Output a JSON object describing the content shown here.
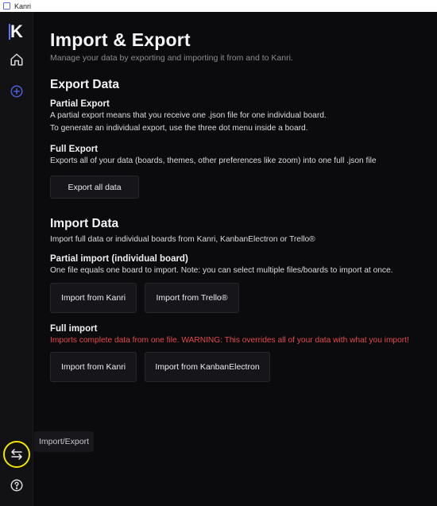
{
  "window": {
    "title": "Kanri"
  },
  "sidebar": {
    "logo": "K",
    "tooltip": "Import/Export"
  },
  "page": {
    "title": "Import & Export",
    "subtitle": "Manage your data by exporting and importing it from and to Kanri."
  },
  "export": {
    "title": "Export Data",
    "partial_title": "Partial Export",
    "partial_line1": "A partial export means that you receive one .json file for one individual board.",
    "partial_line2": "To generate an individual export, use the three dot menu inside a board.",
    "full_title": "Full Export",
    "full_desc": "Exports all of your data (boards, themes, other preferences like zoom) into one full .json file",
    "export_all_label": "Export all data"
  },
  "import": {
    "title": "Import Data",
    "desc": "Import full data or individual boards from Kanri, KanbanElectron or Trello®",
    "partial_title": "Partial import (individual board)",
    "partial_desc": "One file equals one board to import. Note: you can select multiple files/boards to import at once.",
    "partial_kanri_label": "Import from Kanri",
    "partial_trello_label": "Import from Trello®",
    "full_title": "Full import",
    "full_warning": "Imports complete data from one file. WARNING: This overrides all of your data with what you import!",
    "full_kanri_label": "Import from Kanri",
    "full_kanbanelectron_label": "Import from KanbanElectron"
  },
  "colors": {
    "accent": "#5b74ff",
    "warning": "#e5484d",
    "highlight": "#f2e600",
    "background": "#0b0b0d"
  }
}
